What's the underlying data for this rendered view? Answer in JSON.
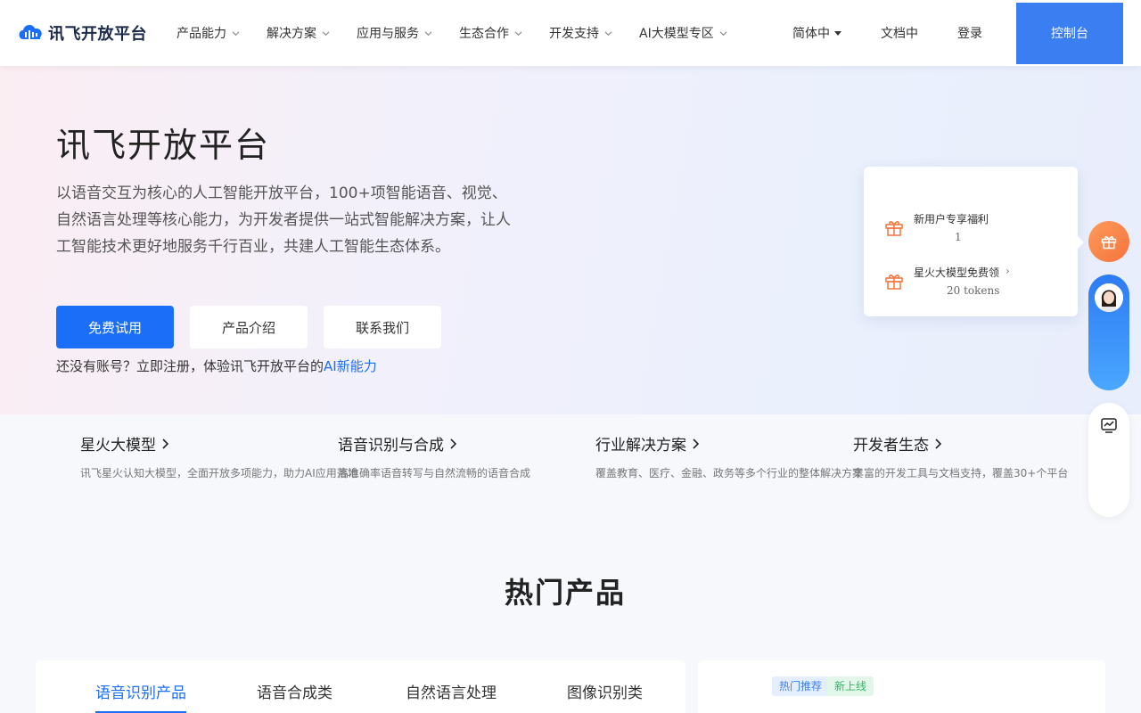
{
  "header": {
    "logo_text": "讯飞开放平台",
    "nav": [
      {
        "label": "产品能力"
      },
      {
        "label": "解决方案"
      },
      {
        "label": "应用与服务"
      },
      {
        "label": "生态合作"
      },
      {
        "label": "开发支持"
      },
      {
        "label": "AI大模型专区"
      }
    ],
    "language": "简体中",
    "docs": "文档中",
    "login": "登录",
    "console": "控制台"
  },
  "hero": {
    "title": "讯飞开放平台",
    "description": "以语音交互为核心的人工智能开放平台，100+项智能语音、视觉、自然语言处理等核心能力，为开发者提供一站式智能解决方案，让人工智能技术更好地服务千行百业，共建人工智能生态体系。",
    "buttons": [
      "免费试用",
      "产品介绍",
      "联系我们"
    ],
    "note_text": "还没有账号？立即注册，体验讯飞开放平台的",
    "note_link": "AI新能力"
  },
  "promo": {
    "items": [
      {
        "title": "新用户专享福利",
        "arrow": "›",
        "sub": "1"
      },
      {
        "title": "星火大模型免费领",
        "arrow": "›",
        "sub": "20 tokens"
      }
    ]
  },
  "features": [
    {
      "title": "星火大模型",
      "desc": "讯飞星火认知大模型，全面开放多项能力，助力AI应用落地"
    },
    {
      "title": "语音识别与合成",
      "desc": "高准确率语音转写与自然流畅的语音合成"
    },
    {
      "title": "行业解决方案",
      "desc": "覆盖教育、医疗、金融、政务等多个行业的整体解决方案"
    },
    {
      "title": "开发者生态",
      "desc": "丰富的开发工具与文档支持，覆盖30+个平台"
    }
  ],
  "section": {
    "title": "热门产品",
    "tabs": [
      "语音识别产品",
      "语音合成类",
      "自然语言处理",
      "图像识别类"
    ],
    "tags": [
      "热门推荐",
      "新上线"
    ]
  },
  "colors": {
    "accent": "#1a6ef7",
    "console_bg": "#3a7ef2",
    "gift_orange": "#f4743c"
  }
}
